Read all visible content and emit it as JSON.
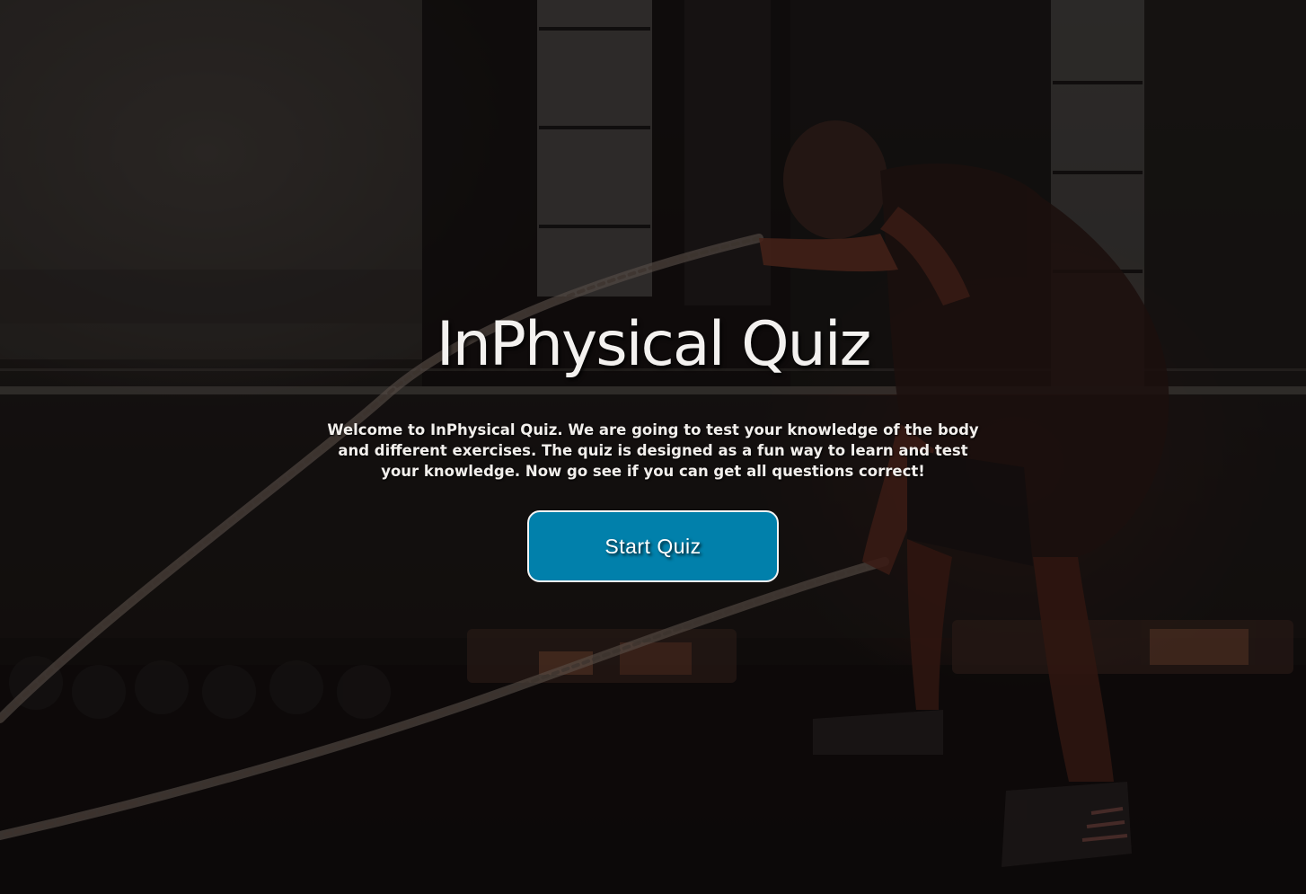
{
  "page": {
    "title": "InPhysical Quiz",
    "intro_lines": [
      "Welcome to InPhysical Quiz. We are going to test your knowledge of the body",
      "and different exercises. The quiz is designed as a fun way to learn and test",
      "your knowledge. Now go see if you can get all questions correct!"
    ],
    "start_button_label": "Start Quiz"
  },
  "background": {
    "subject": "gym-battle-ropes-photo",
    "overlay_color": "#000000"
  },
  "colors": {
    "button_bg": "#0180ab",
    "button_border": "#f4f4f4",
    "title_text": "#f3f1ef",
    "body_text": "#f2efec"
  }
}
